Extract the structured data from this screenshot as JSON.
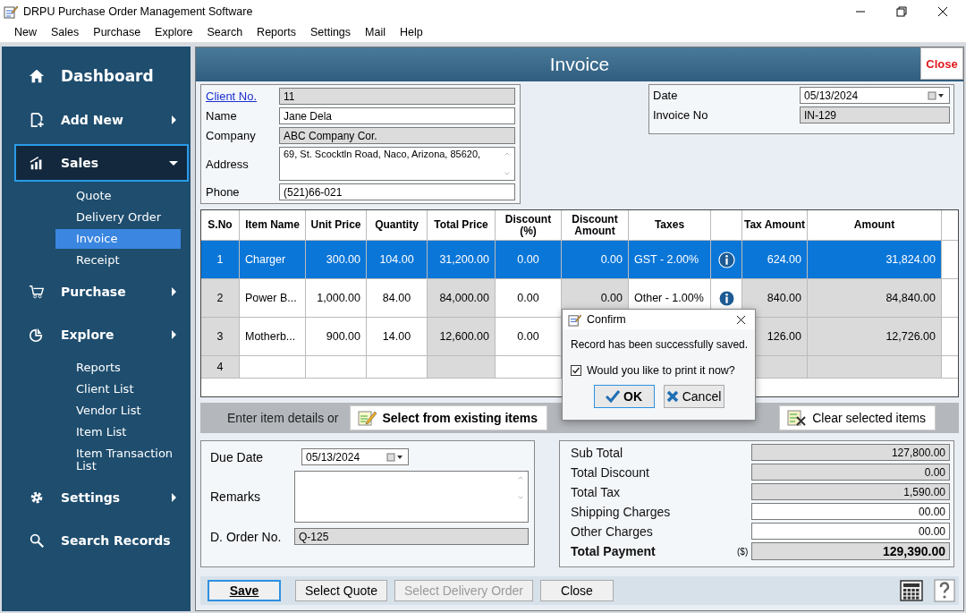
{
  "window": {
    "title": "DRPU Purchase Order Management Software"
  },
  "menu": [
    "New",
    "Sales",
    "Purchase",
    "Explore",
    "Search",
    "Reports",
    "Settings",
    "Mail",
    "Help"
  ],
  "sidebar": {
    "items": [
      {
        "label": "Dashboard",
        "kind": "link",
        "selected": false
      },
      {
        "label": "Add New",
        "kind": "menu",
        "expanded": false,
        "selected": false
      },
      {
        "label": "Sales",
        "kind": "menu",
        "expanded": true,
        "selected": true,
        "children": [
          {
            "label": "Quote",
            "selected": false
          },
          {
            "label": "Delivery Order",
            "selected": false
          },
          {
            "label": "Invoice",
            "selected": true
          },
          {
            "label": "Receipt",
            "selected": false
          }
        ]
      },
      {
        "label": "Purchase",
        "kind": "menu",
        "expanded": false,
        "selected": false
      },
      {
        "label": "Explore",
        "kind": "menu",
        "expanded": false,
        "selected": false,
        "children": [
          {
            "label": "Reports",
            "selected": false
          },
          {
            "label": "Client List",
            "selected": false
          },
          {
            "label": "Vendor List",
            "selected": false
          },
          {
            "label": "Item List",
            "selected": false
          },
          {
            "label": "Item Transaction List",
            "selected": false
          }
        ]
      },
      {
        "label": "Settings",
        "kind": "menu",
        "expanded": false,
        "selected": false
      },
      {
        "label": "Search Records",
        "kind": "link",
        "selected": false
      }
    ]
  },
  "header": {
    "title": "Invoice",
    "close": "Close"
  },
  "client": {
    "link": "Client No.",
    "fields": [
      {
        "label": "Name",
        "value": "Jane Dela",
        "disabled": false
      },
      {
        "label": "Company",
        "value": "ABC Company Cor.",
        "disabled": true
      },
      {
        "label": "Address",
        "value": "69, St. Scocktln Road, Naco, Arizona, 85620,",
        "disabled": false,
        "multiline": true
      },
      {
        "label": "Phone",
        "value": "(521)66-021",
        "disabled": false
      }
    ],
    "client_no": "11"
  },
  "invoice_info": {
    "date_label": "Date",
    "date": "05/13/2024",
    "number_label": "Invoice No",
    "number": "IN-129"
  },
  "table": {
    "columns": [
      "S.No",
      "Item Name",
      "Unit Price",
      "Quantity",
      "Total Price",
      "Discount (%)",
      "Discount Amount",
      "Taxes",
      "Tax Amount",
      "Amount"
    ],
    "rows": [
      {
        "selected": true,
        "sno": "1",
        "item": "Charger",
        "unit_price": "300.00",
        "quantity": "104.00",
        "total_price": "31,200.00",
        "discount_pct": "0.00",
        "discount_amount": "0.00",
        "taxes": "GST - 2.00%",
        "tax_amount": "624.00",
        "amount": "31,824.00"
      },
      {
        "selected": false,
        "sno": "2",
        "item": "Power B...",
        "unit_price": "1,000.00",
        "quantity": "84.00",
        "total_price": "84,000.00",
        "discount_pct": "0.00",
        "discount_amount": "0.00",
        "taxes": "Other - 1.00%",
        "tax_amount": "840.00",
        "amount": "84,840.00"
      },
      {
        "selected": false,
        "sno": "3",
        "item": "Motherb...",
        "unit_price": "900.00",
        "quantity": "14.00",
        "total_price": "12,600.00",
        "discount_pct": "0.00",
        "tax_amount": "126.00",
        "amount": "12,726.00"
      },
      {
        "selected": false,
        "sno": "4"
      }
    ]
  },
  "item_bar": {
    "prompt": "Enter item details or",
    "select_existing": "Select from existing items",
    "clear": "Clear selected items"
  },
  "details": {
    "due_date_label": "Due Date",
    "due_date": "05/13/2024",
    "remarks_label": "Remarks",
    "order_label": "D. Order No.",
    "order_no": "Q-125"
  },
  "totals": [
    {
      "label": "Sub Total",
      "value": "127,800.00",
      "disabled": true
    },
    {
      "label": "Total Discount",
      "value": "0.00",
      "disabled": true
    },
    {
      "label": "Total Tax",
      "value": "1,590.00",
      "disabled": true
    },
    {
      "label": "Shipping Charges",
      "value": "00.00",
      "disabled": false
    },
    {
      "label": "Other Charges",
      "value": "00.00",
      "disabled": false
    }
  ],
  "total_payment": {
    "label": "Total Payment",
    "currency": "($)",
    "value": "129,390.00"
  },
  "buttons": [
    {
      "label": "Save",
      "disabled": false,
      "selected": true
    },
    {
      "label": "Select Quote",
      "disabled": false,
      "selected": false
    },
    {
      "label": "Select Delivery Order",
      "disabled": true,
      "selected": false
    },
    {
      "label": "Close",
      "disabled": false,
      "selected": false
    }
  ],
  "dialog": {
    "title": "Confirm",
    "message": "Record has been successfully saved.",
    "checkbox": {
      "label": "Would you like to print it now?",
      "checked": true
    },
    "ok": "OK",
    "cancel": "Cancel"
  }
}
